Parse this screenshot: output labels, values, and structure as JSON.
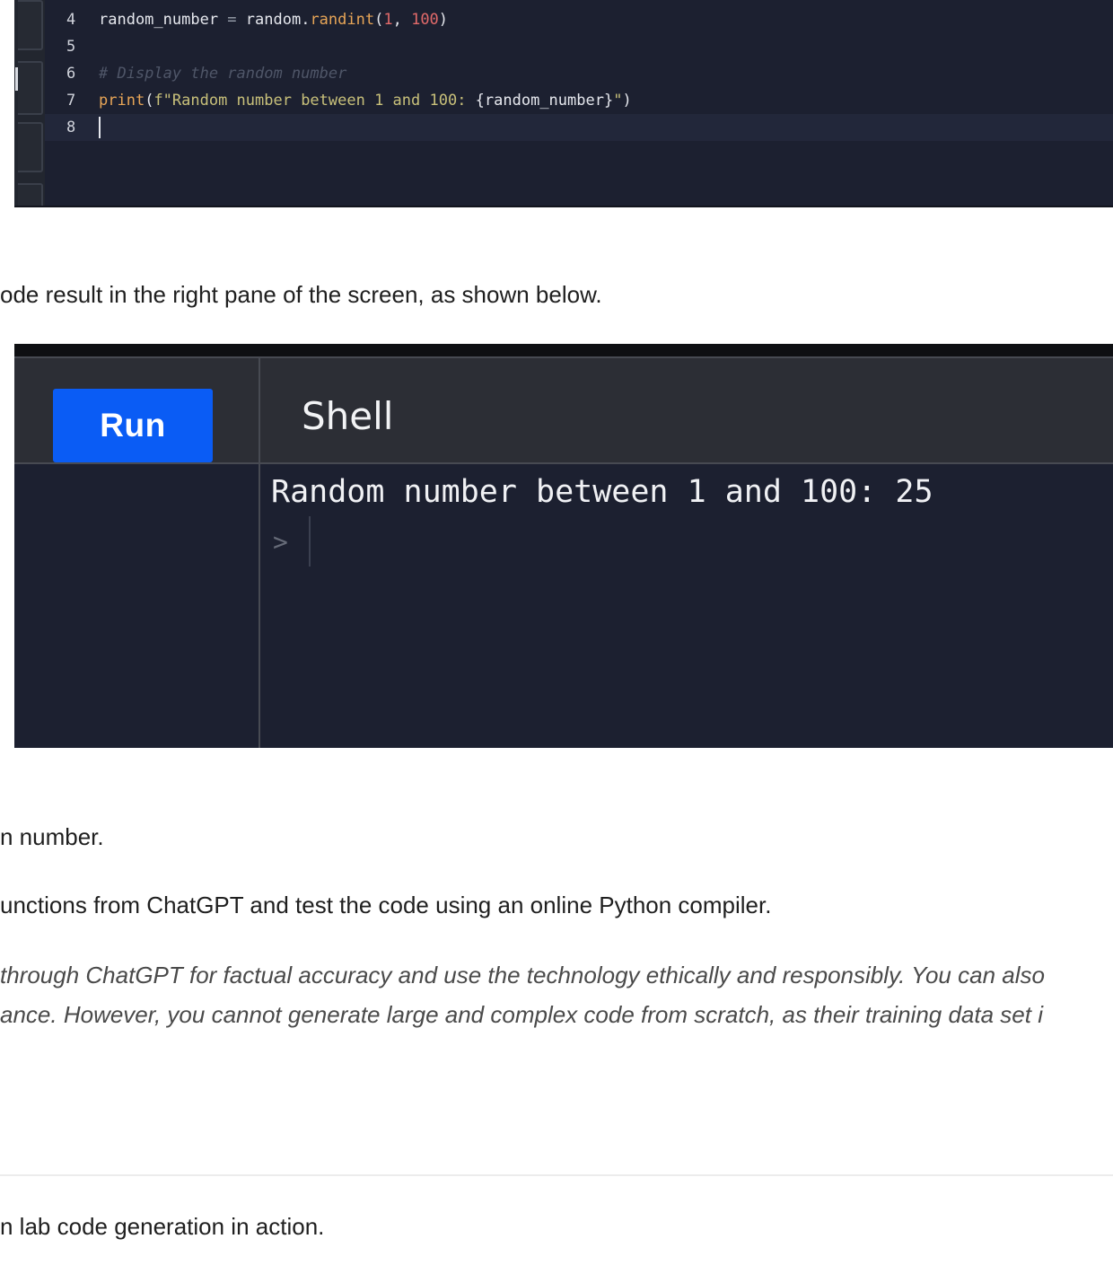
{
  "editor": {
    "lines": [
      {
        "num": "4",
        "tokens": [
          {
            "t": "random_number ",
            "c": ""
          },
          {
            "t": "=",
            "c": "tok-op"
          },
          {
            "t": " random.",
            "c": ""
          },
          {
            "t": "randint",
            "c": "tok-fn"
          },
          {
            "t": "(",
            "c": ""
          },
          {
            "t": "1",
            "c": "tok-num"
          },
          {
            "t": ", ",
            "c": ""
          },
          {
            "t": "100",
            "c": "tok-num"
          },
          {
            "t": ")",
            "c": ""
          }
        ]
      },
      {
        "num": "5",
        "tokens": []
      },
      {
        "num": "6",
        "tokens": [
          {
            "t": "# Display the random number",
            "c": "tok-comment"
          }
        ]
      },
      {
        "num": "7",
        "tokens": [
          {
            "t": "print",
            "c": "tok-fn"
          },
          {
            "t": "(",
            "c": ""
          },
          {
            "t": "f\"Random number between 1 and 100: ",
            "c": "tok-str"
          },
          {
            "t": "{random_number}",
            "c": ""
          },
          {
            "t": "\"",
            "c": "tok-str"
          },
          {
            "t": ")",
            "c": ""
          }
        ]
      },
      {
        "num": "8",
        "tokens": [],
        "current": true
      }
    ]
  },
  "text": {
    "intro": "ode result in the right pane of the screen, as shown below.",
    "p1": "n number.",
    "p2": "unctions from ChatGPT and test the code using an online Python compiler.",
    "note1": "through ChatGPT for factual accuracy and use the technology ethically and responsibly. You can also",
    "note2": "ance. However, you cannot generate large and complex code from scratch, as their training data set i",
    "p3": "n lab code generation in action."
  },
  "runner": {
    "run_label": "Run",
    "shell_title": "Shell",
    "output": "Random number between 1 and 100: 25",
    "prompt": ">"
  },
  "colors": {
    "run_button": "#0a5cf5",
    "panel_bg": "#1c2030",
    "header_bg": "#2c2e35"
  }
}
